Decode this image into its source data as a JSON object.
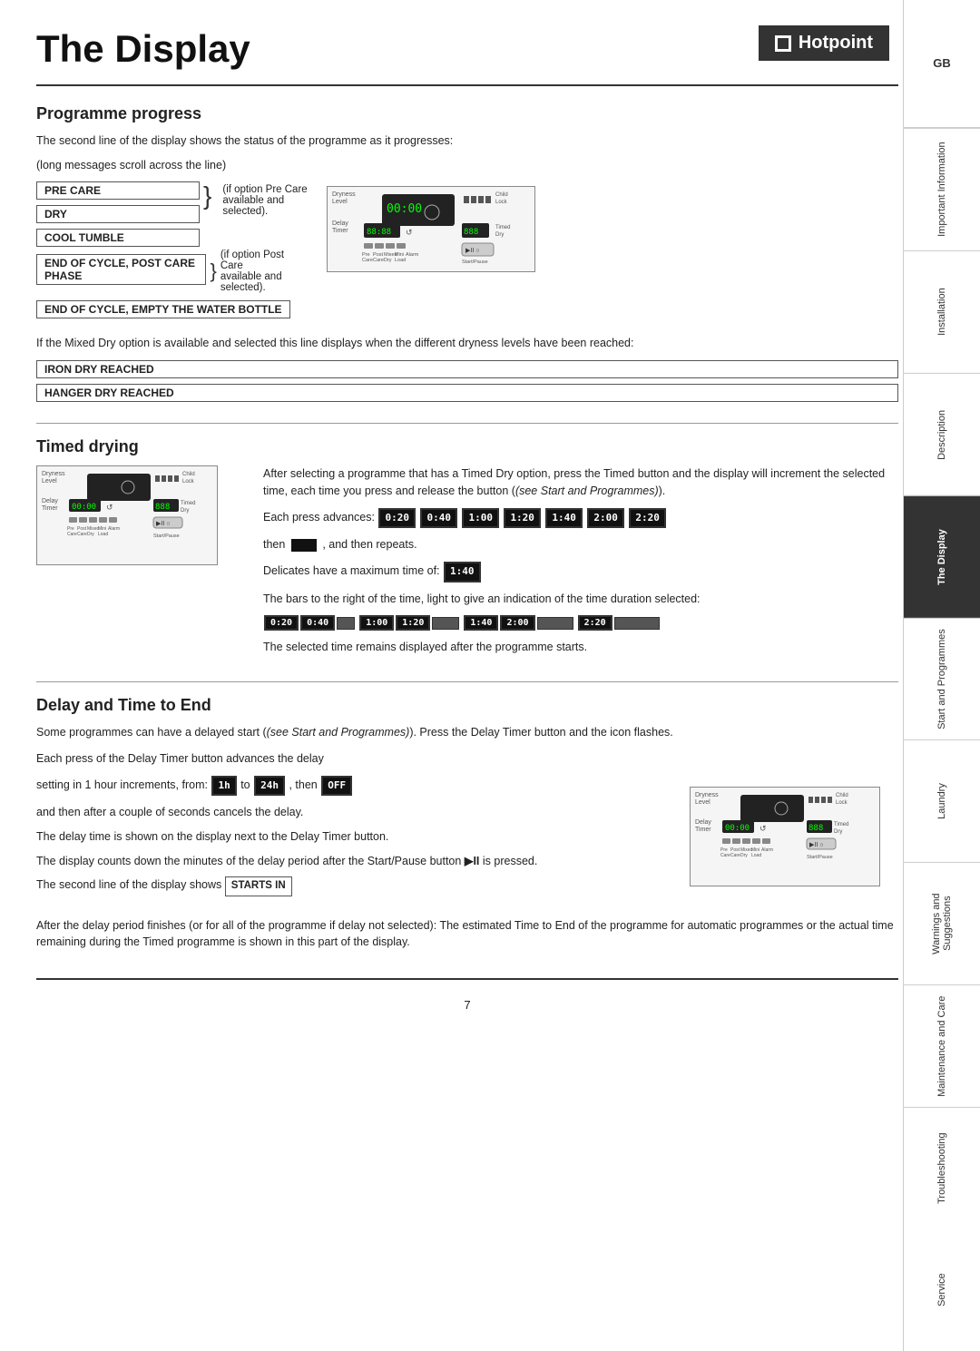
{
  "page": {
    "title": "The Display",
    "page_number": "7"
  },
  "brand": {
    "name": "Hotpoint"
  },
  "programme_progress": {
    "heading": "Programme progress",
    "intro1": "The second line of the display shows the status of the programme as it progresses:",
    "intro2": "(long messages scroll across the line)",
    "items": [
      {
        "label": "PRE CARE"
      },
      {
        "label": "DRY"
      },
      {
        "label": "COOL TUMBLE"
      },
      {
        "label": "END OF CYCLE, POST CARE PHASE"
      }
    ],
    "annotation1_label": "(if option Pre Care",
    "annotation1_text": "available and selected).",
    "annotation2_label": "(if option Post Care",
    "annotation2_text": "available and selected).",
    "end_cycle_box": "END OF CYCLE, EMPTY THE WATER BOTTLE",
    "mixed_dry_text": "If the Mixed Dry option is available and selected this line displays when the different dryness levels have been reached:",
    "iron_dry": "IRON DRY REACHED",
    "hanger_dry": "HANGER DRY REACHED"
  },
  "timed_drying": {
    "heading": "Timed drying",
    "para1": "After selecting a programme that has a Timed Dry option, press the Timed button and the display will increment the selected time, each time you press and release the button",
    "para1_italic": "(see Start and Programmes)",
    "advances_label": "Each press advances:",
    "advances_values": [
      "0:20",
      "0:40",
      "1:00",
      "1:20",
      "1:40",
      "2:00",
      "2:20"
    ],
    "then_text": "then",
    "then_suffix": ", and then repeats.",
    "delicates_text": "Delicates have a maximum time of:",
    "delicates_time": "1:40",
    "bars_text": "The bars to the right of the time, light to give an indication of the time duration selected:",
    "starts_text": "The selected time remains displayed after the programme starts."
  },
  "delay_time": {
    "heading": "Delay and Time to End",
    "para1": "Some programmes can have a delayed start",
    "para1_italic": "(see Start and Programmes)",
    "para1_suffix": ". Press the Delay Timer button and the icon flashes.",
    "para2": "Each press of the Delay Timer button advances the delay",
    "setting_text": "setting in 1 hour increments, from:",
    "from_val": "1h",
    "to_label": "to",
    "to_val": "24h",
    "then_val": "OFF",
    "then_label": ", then",
    "cancel_text": "and then after a couple of seconds cancels the delay.",
    "delay_display_text": "The delay time is shown on the display next to the Delay Timer button.",
    "countdown_text": "The display counts down the minutes of the delay period after the Start/Pause button",
    "startpause_symbol": "▶II",
    "pressed_text": "is pressed.",
    "second_line_text": "The second line of the display shows",
    "starts_in_box": "STARTS IN",
    "after_delay_text": "After the delay period finishes (or for all of the programme if delay not selected): The estimated Time to End of the programme for automatic programmes or the actual time remaining during the Timed programme is shown in this part of the display."
  },
  "sidebar": {
    "items": [
      {
        "label": "GB",
        "active": false,
        "is_gb": true
      },
      {
        "label": "Important Information",
        "active": false
      },
      {
        "label": "Installation",
        "active": false
      },
      {
        "label": "Description",
        "active": false
      },
      {
        "label": "The Display",
        "active": true
      },
      {
        "label": "Start and Programmes",
        "active": false
      },
      {
        "label": "Laundry",
        "active": false
      },
      {
        "label": "Warnings and Suggestions",
        "active": false
      },
      {
        "label": "Maintenance and Care",
        "active": false
      },
      {
        "label": "Troubleshooting",
        "active": false
      },
      {
        "label": "Service",
        "active": false
      }
    ]
  }
}
